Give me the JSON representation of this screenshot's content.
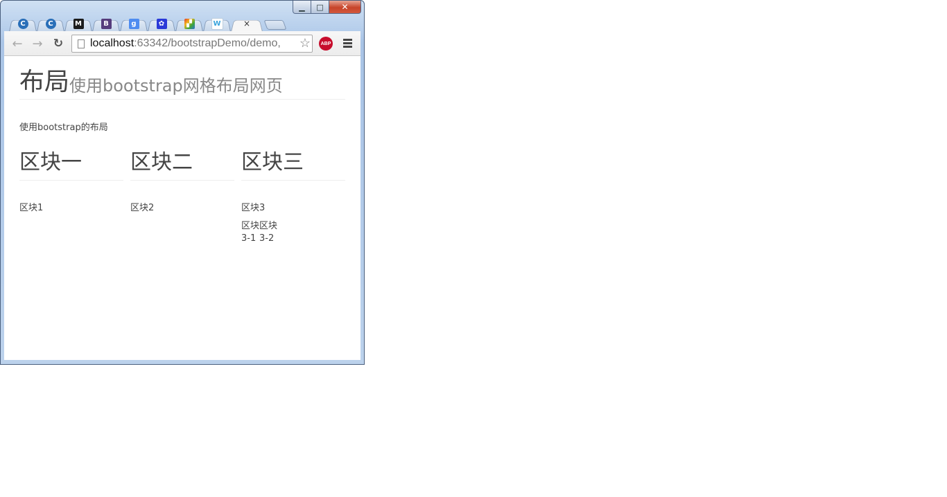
{
  "window": {
    "controls": {
      "minimize": "▁",
      "maximize": "□",
      "close": "✕"
    }
  },
  "tabs": [
    {
      "icon": "chrome-c-icon",
      "glyph": "C",
      "color": "#2a6fb8"
    },
    {
      "icon": "chrome-c-icon",
      "glyph": "C",
      "color": "#2a6fb8"
    },
    {
      "icon": "m-icon",
      "glyph": "M",
      "color": "#1c1c1c"
    },
    {
      "icon": "bootstrap-b-icon",
      "glyph": "B",
      "color": "#563d7c"
    },
    {
      "icon": "google-g-icon",
      "glyph": "g",
      "color": "#4e8cf0"
    },
    {
      "icon": "baidu-paw-icon",
      "glyph": "✿",
      "color": "#2b3ad8"
    },
    {
      "icon": "colorful-app-icon",
      "glyph": "▞",
      "color": "#e03c2a"
    },
    {
      "icon": "w-icon",
      "glyph": "W",
      "color": "#3aa4dd"
    }
  ],
  "active_tab": {
    "close": "×"
  },
  "toolbar": {
    "back": "←",
    "forward": "→",
    "reload": "↻",
    "url_host": "localhost",
    "url_rest": ":63342/bootstrapDemo/demo,",
    "star": "☆",
    "abp": "ABP"
  },
  "page": {
    "title": "布局",
    "subtitle": "使用bootstrap网格布局网页",
    "lead": "使用bootstrap的布局",
    "columns": [
      {
        "heading": "区块一",
        "text": "区块1"
      },
      {
        "heading": "区块二",
        "text": "区块2"
      },
      {
        "heading": "区块三",
        "text": "区块3"
      }
    ],
    "subcols": [
      "区块3-1",
      "区块3-2"
    ]
  }
}
